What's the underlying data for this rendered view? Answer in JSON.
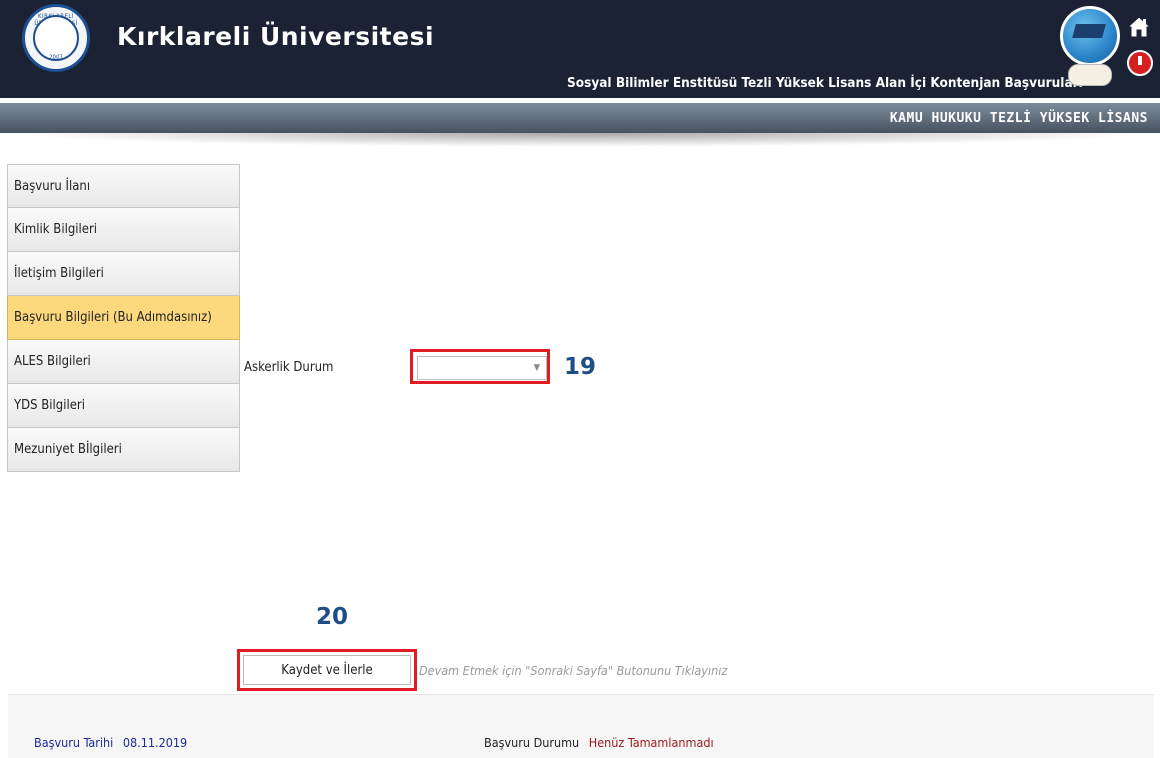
{
  "header": {
    "university_name": "Kırklareli Üniversitesi",
    "subtitle": "Sosyal Bilimler Enstitüsü Tezli Yüksek Lisans Alan İçi Kontenjan Başvuruları",
    "logo_ring_text": "KIRKLARELİ ÜNİVERSİTESİ",
    "logo_year": "2007"
  },
  "program_title": "KAMU HUKUKU TEZLİ YÜKSEK LİSANS",
  "sidebar": {
    "items": [
      {
        "label": "Başvuru İlanı"
      },
      {
        "label": "Kimlik Bilgileri"
      },
      {
        "label": "İletişim Bilgileri"
      },
      {
        "label": "Başvuru Bilgileri (Bu Adımdasınız)"
      },
      {
        "label": "ALES Bilgileri"
      },
      {
        "label": "YDS Bilgileri"
      },
      {
        "label": "Mezuniyet Bİlgileri"
      }
    ]
  },
  "form": {
    "military_label": "Askerlik Durum",
    "military_value": "",
    "save_button": "Kaydet ve İlerle",
    "hint": "Devam Etmek için \"Sonraki Sayfa\" Butonunu Tıklayınız"
  },
  "annotations": {
    "n19": "19",
    "n20": "20"
  },
  "footer": {
    "date_label": "Başvuru Tarihi",
    "date_value": "08.11.2019",
    "status_label": "Başvuru Durumu",
    "status_value": "Henüz Tamamlanmadı"
  },
  "icons": {
    "home": "home-icon",
    "power": "power-icon",
    "dropdown": "chevron-down-icon"
  }
}
